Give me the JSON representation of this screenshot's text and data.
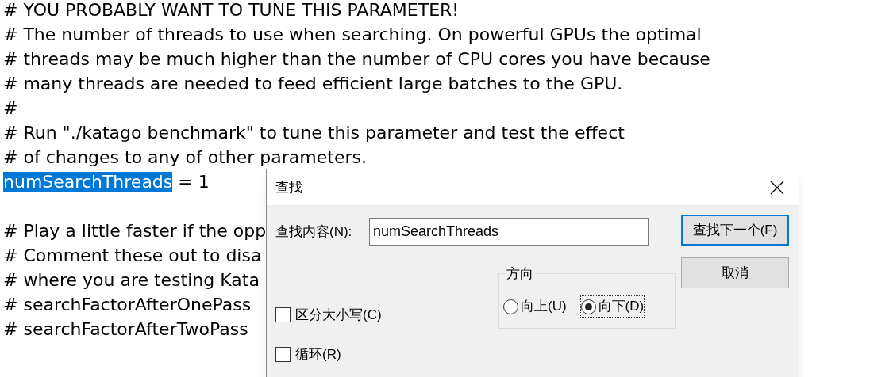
{
  "editor": {
    "lines": [
      {
        "kind": "text",
        "segments": [
          {
            "text": "# YOU PROBABLY WANT TO TUNE THIS PARAMETER!",
            "selected": false
          }
        ]
      },
      {
        "kind": "text",
        "segments": [
          {
            "text": "# The number of threads to use when searching. On powerful GPUs the optimal",
            "selected": false
          }
        ]
      },
      {
        "kind": "text",
        "segments": [
          {
            "text": "# threads may be much higher than the number of CPU cores you have because",
            "selected": false
          }
        ]
      },
      {
        "kind": "text",
        "segments": [
          {
            "text": "# many threads are needed to feed efficient large batches to the GPU.",
            "selected": false
          }
        ]
      },
      {
        "kind": "text",
        "segments": [
          {
            "text": "#",
            "selected": false
          }
        ]
      },
      {
        "kind": "text",
        "segments": [
          {
            "text": "# Run \"./katago benchmark\" to tune this parameter and test the effect",
            "selected": false
          }
        ]
      },
      {
        "kind": "text",
        "segments": [
          {
            "text": "# of changes to any of other parameters.",
            "selected": false
          }
        ]
      },
      {
        "kind": "text",
        "segments": [
          {
            "text": "numSearchThreads",
            "selected": true
          },
          {
            "text": " = 1",
            "selected": false
          }
        ]
      },
      {
        "kind": "blank"
      },
      {
        "kind": "text",
        "segments": [
          {
            "text": "# Play a little faster if the opp",
            "selected": false
          }
        ]
      },
      {
        "kind": "text",
        "segments": [
          {
            "text": "# Comment these out to disa",
            "selected": false
          }
        ]
      },
      {
        "kind": "text",
        "segments": [
          {
            "text": "# where you are testing Kata",
            "selected": false
          }
        ]
      },
      {
        "kind": "text",
        "segments": [
          {
            "text": "# searchFactorAfterOnePass",
            "selected": false
          }
        ]
      },
      {
        "kind": "text",
        "segments": [
          {
            "text": "# searchFactorAfterTwoPass",
            "selected": false
          }
        ]
      }
    ]
  },
  "dialog": {
    "title": "查找",
    "find_label": "查找内容(N):",
    "find_value": "numSearchThreads",
    "buttons": [
      {
        "label": "查找下一个(F)",
        "default": true
      },
      {
        "label": "取消",
        "default": false
      }
    ],
    "options": [
      {
        "label": "区分大小写(C)",
        "checked": false
      },
      {
        "label": "循环(R)",
        "checked": false
      }
    ],
    "direction": {
      "title": "方向",
      "choices": [
        {
          "label": "向上(U)",
          "selected": false
        },
        {
          "label": "向下(D)",
          "selected": true
        }
      ]
    }
  }
}
